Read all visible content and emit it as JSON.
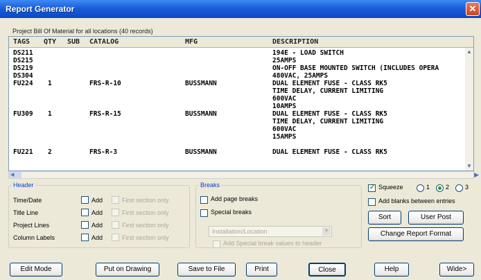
{
  "window": {
    "title": "Report Generator",
    "close_glyph": "✕"
  },
  "caption": "Project Bill Of Material for all locations (40 records)",
  "columns": [
    "TAGS",
    "QTY",
    "SUB",
    "CATALOG",
    "MFG",
    "DESCRIPTION"
  ],
  "rows": [
    [
      "DS211",
      "",
      "",
      "",
      "",
      "194E - LOAD SWITCH"
    ],
    [
      "DS215",
      "",
      "",
      "",
      "",
      "25AMPS"
    ],
    [
      "DS219",
      "",
      "",
      "",
      "",
      "ON-OFF BASE MOUNTED SWITCH (INCLUDES OPERA"
    ],
    [
      "DS304",
      "",
      "",
      "",
      "",
      "480VAC, 25AMPS"
    ],
    [
      "FU224",
      "1",
      "",
      "FRS-R-10",
      "BUSSMANN",
      "DUAL ELEMENT FUSE - CLASS RK5"
    ],
    [
      "",
      "",
      "",
      "",
      "",
      "TIME DELAY, CURRENT LIMITING"
    ],
    [
      "",
      "",
      "",
      "",
      "",
      "600VAC"
    ],
    [
      "",
      "",
      "",
      "",
      "",
      "10AMPS"
    ],
    [
      "FU309",
      "1",
      "",
      "FRS-R-15",
      "BUSSMANN",
      "DUAL ELEMENT FUSE - CLASS RK5"
    ],
    [
      "",
      "",
      "",
      "",
      "",
      "TIME DELAY, CURRENT LIMITING"
    ],
    [
      "",
      "",
      "",
      "",
      "",
      "600VAC"
    ],
    [
      "",
      "",
      "",
      "",
      "",
      "15AMPS"
    ],
    [
      "",
      "",
      "",
      "",
      "",
      ""
    ],
    [
      "FU221",
      "2",
      "",
      "FRS-R-3",
      "BUSSMANN",
      "DUAL ELEMENT FUSE - CLASS RK5"
    ]
  ],
  "header_group": {
    "legend": "Header",
    "rows": [
      {
        "label": "Time/Date",
        "add": "Add",
        "first": "First section only"
      },
      {
        "label": "Title Line",
        "add": "Add",
        "first": "First section only"
      },
      {
        "label": "Project Lines",
        "add": "Add",
        "first": "First section only"
      },
      {
        "label": "Column Labels",
        "add": "Add",
        "first": "First section only"
      }
    ]
  },
  "breaks_group": {
    "legend": "Breaks",
    "add_page_breaks": "Add page breaks",
    "special_breaks": "Special breaks",
    "select_value": "Installation/Location",
    "add_special": "Add Special break values to header"
  },
  "options": {
    "squeeze": "Squeeze",
    "squeeze_checked": true,
    "radios": [
      "1",
      "2",
      "3"
    ],
    "radio_selected": "2",
    "add_blanks": "Add blanks between entries",
    "sort": "Sort",
    "user_post": "User Post",
    "change_format": "Change Report Format"
  },
  "buttons": {
    "edit_mode": "Edit Mode",
    "put_on_drawing": "Put on Drawing",
    "save_to_file": "Save to File",
    "print": "Print",
    "close": "Close",
    "help": "Help",
    "wide": "Wide>"
  },
  "icons": {
    "scroll_up": "▲",
    "scroll_down": "▼",
    "scroll_left": "◀",
    "scroll_right": "▶",
    "select_arrow": "▼"
  },
  "colors": {
    "title_bar": "#1a5fd8",
    "group_legend": "#0046d5",
    "check_mark": "#21a121"
  }
}
